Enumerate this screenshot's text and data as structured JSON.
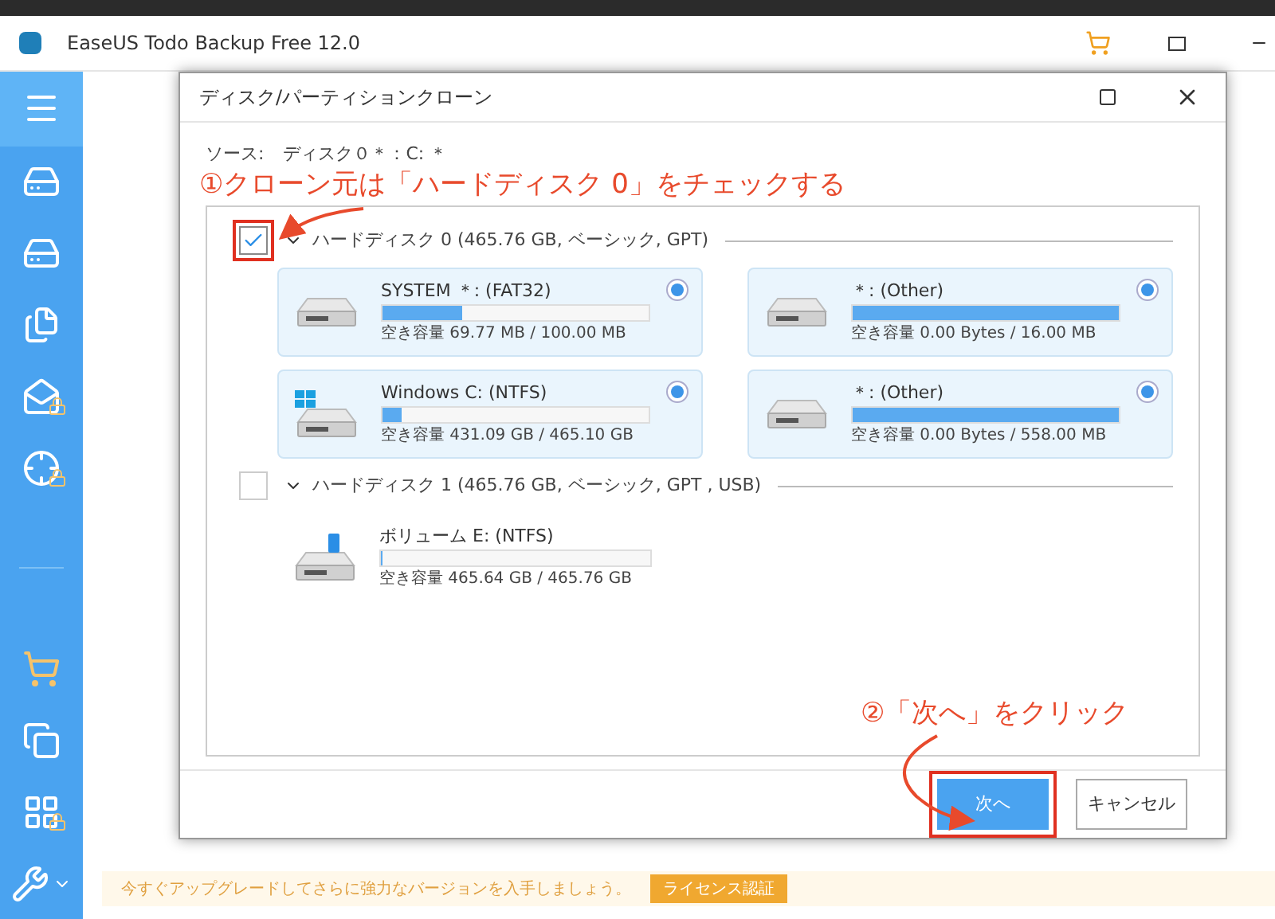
{
  "app": {
    "title": "EaseUS Todo Backup Free 12.0"
  },
  "sidebar": {
    "items": [
      {
        "kind": "menu"
      },
      {
        "kind": "disk"
      },
      {
        "kind": "partition"
      },
      {
        "kind": "file"
      },
      {
        "kind": "mail"
      },
      {
        "kind": "system"
      },
      {
        "kind": "divider"
      },
      {
        "kind": "cart"
      },
      {
        "kind": "clone"
      },
      {
        "kind": "windows"
      },
      {
        "kind": "tools"
      }
    ]
  },
  "dialog": {
    "title": "ディスク/パーティションクローン",
    "source_label": "ソース:",
    "source_value": "ディスク０＊：C: ＊",
    "disks": [
      {
        "label": "ハードディスク 0 (465.76 GB, ベーシック, GPT)",
        "checked": true,
        "partitions": [
          {
            "kind": "drive",
            "name": "SYSTEM ＊: (FAT32)",
            "level": 0.3,
            "free": "空き容量 69.77 MB / 100.00 MB",
            "selected": true
          },
          {
            "kind": "drive",
            "name": "＊: (Other)",
            "level": 1,
            "free": "空き容量 0.00 Bytes / 16.00 MB",
            "selected": true
          },
          {
            "kind": "windows",
            "name": "Windows C: (NTFS)",
            "level": 0.07,
            "free": "空き容量 431.09 GB / 465.10 GB",
            "selected": true
          },
          {
            "kind": "drive",
            "name": "＊: (Other)",
            "level": 1,
            "free": "空き容量 0.00 Bytes / 558.00 MB",
            "selected": true
          }
        ]
      },
      {
        "label": "ハードディスク 1 (465.76 GB, ベーシック, GPT , USB)",
        "checked": false,
        "partitions": [
          {
            "kind": "usb",
            "name": "ボリューム E: (NTFS)",
            "level": 0.003,
            "free": "空き容量 465.64 GB / 465.76 GB",
            "selected": false
          }
        ]
      }
    ],
    "buttons": [
      {
        "label": "次へ",
        "primary": true
      },
      {
        "label": "キャンセル",
        "primary": false
      }
    ]
  },
  "annotations": [
    "①クローン元は「ハードディスク 0」をチェックする",
    "②「次へ」をクリック"
  ],
  "banner": {
    "text": "今すぐアップグレードしてさらに強力なバージョンを入手しましょう。",
    "button": "ライセンス認証"
  }
}
